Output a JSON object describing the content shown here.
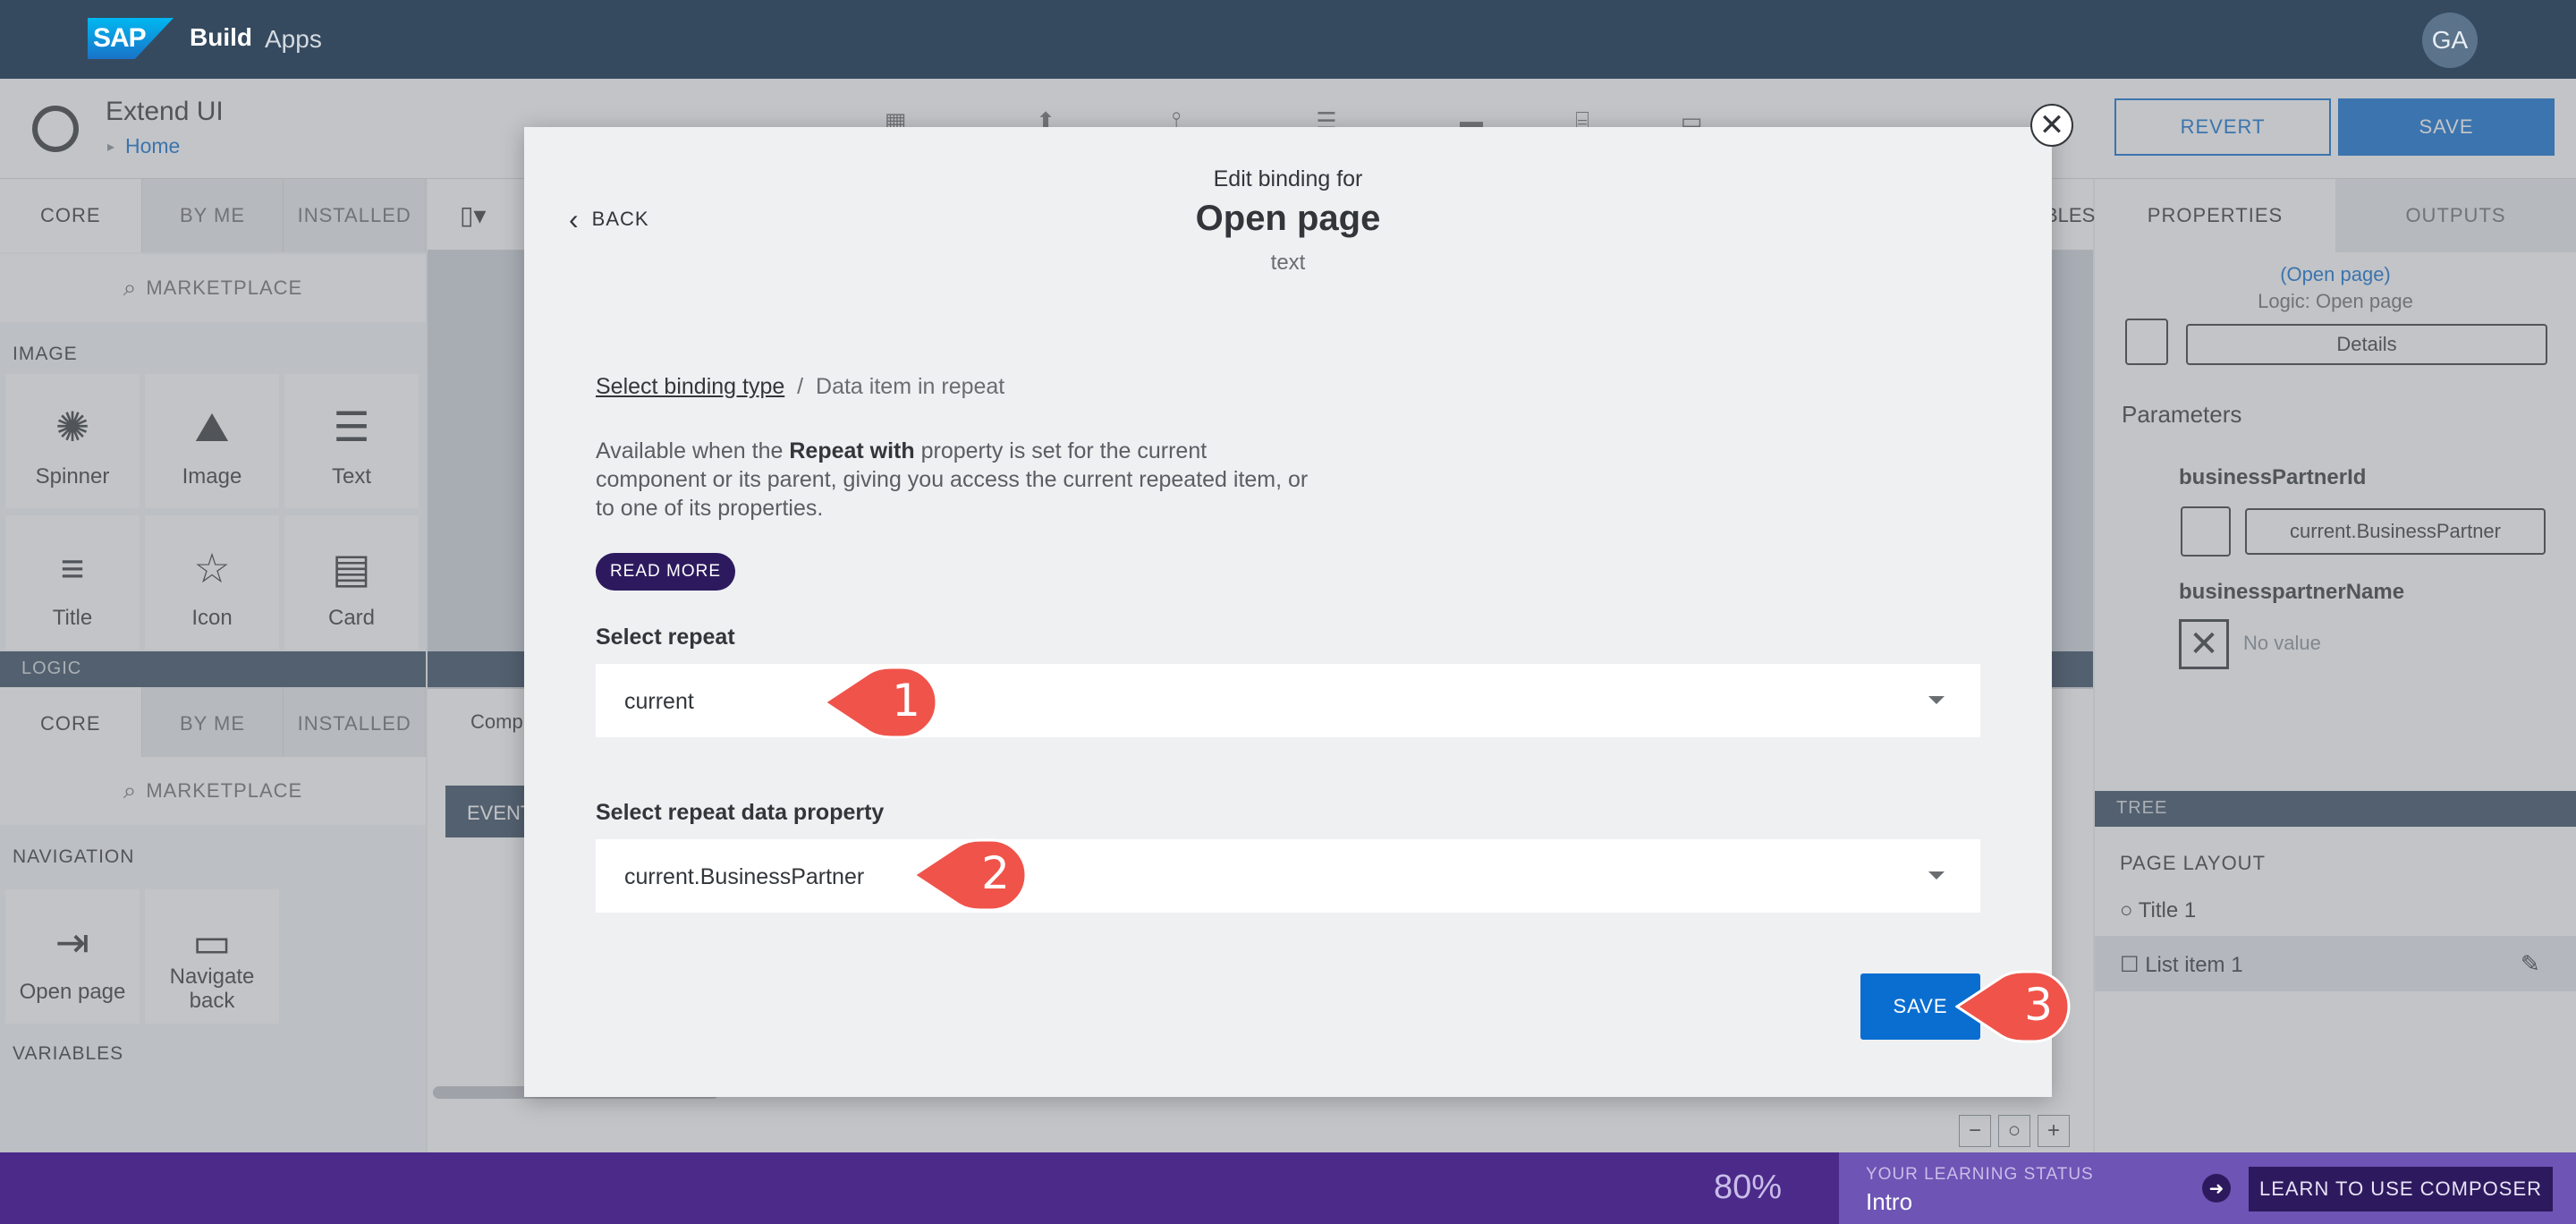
{
  "shell": {
    "logo": "SAP",
    "product": "Build",
    "suffix": "Apps",
    "avatar": "GA"
  },
  "app_header": {
    "title": "Extend UI",
    "breadcrumb": "Home",
    "revert_label": "REVERT",
    "save_label": "SAVE"
  },
  "left_panel": {
    "tabs": [
      "CORE",
      "BY ME",
      "INSTALLED"
    ],
    "marketplace": "MARKETPLACE",
    "section_image": "IMAGE",
    "components": [
      "Spinner",
      "Image",
      "Text",
      "Title",
      "Icon",
      "Card"
    ],
    "logic_bar": "LOGIC",
    "logic_tabs": [
      "CORE",
      "BY ME",
      "INSTALLED"
    ],
    "logic_marketplace": "MARKETPLACE",
    "section_navigation": "NAVIGATION",
    "nav_items": [
      "Open page",
      "Navigate back"
    ],
    "section_variables": "VARIABLES"
  },
  "canvas": {
    "partial_right_label": "BLES",
    "event_label": "EVENT",
    "components_tab": "Comp"
  },
  "right_panel": {
    "tabs": [
      "PROPERTIES",
      "OUTPUTS"
    ],
    "selected_name": "(Open page)",
    "selected_type": "Logic: Open page",
    "details_label": "Details",
    "parameters_label": "Parameters",
    "param1_name": "businessPartnerId",
    "param1_value": "current.BusinessPartner",
    "param2_name": "businesspartnerName",
    "param2_value": "No value",
    "tree_label": "TREE",
    "page_layout": "PAGE LAYOUT",
    "tree_items": [
      "Title 1",
      "List item 1"
    ]
  },
  "learning": {
    "percent": "80%",
    "status_label": "YOUR LEARNING STATUS",
    "status_value": "Intro",
    "button": "LEARN TO USE COMPOSER"
  },
  "modal": {
    "back_label": "BACK",
    "subtitle": "Edit binding for",
    "title": "Open page",
    "type": "text",
    "crumb_link": "Select binding type",
    "crumb_sep": "/",
    "crumb_current": "Data item in repeat",
    "desc_pre": "Available when the ",
    "desc_bold": "Repeat with",
    "desc_post": " property is set for the current component or its parent, giving you access the current repeated item, or to one of its properties.",
    "read_more": "READ MORE",
    "select_repeat_label": "Select repeat",
    "select_repeat_value": "current",
    "select_property_label": "Select repeat data property",
    "select_property_value": "current.BusinessPartner",
    "save_label": "SAVE"
  },
  "callouts": [
    "1",
    "2",
    "3"
  ],
  "colors": {
    "brand_blue": "#0a6ed1",
    "shell": "#354a5f",
    "callout": "#f0534a",
    "learning": "#4b2a8a"
  }
}
